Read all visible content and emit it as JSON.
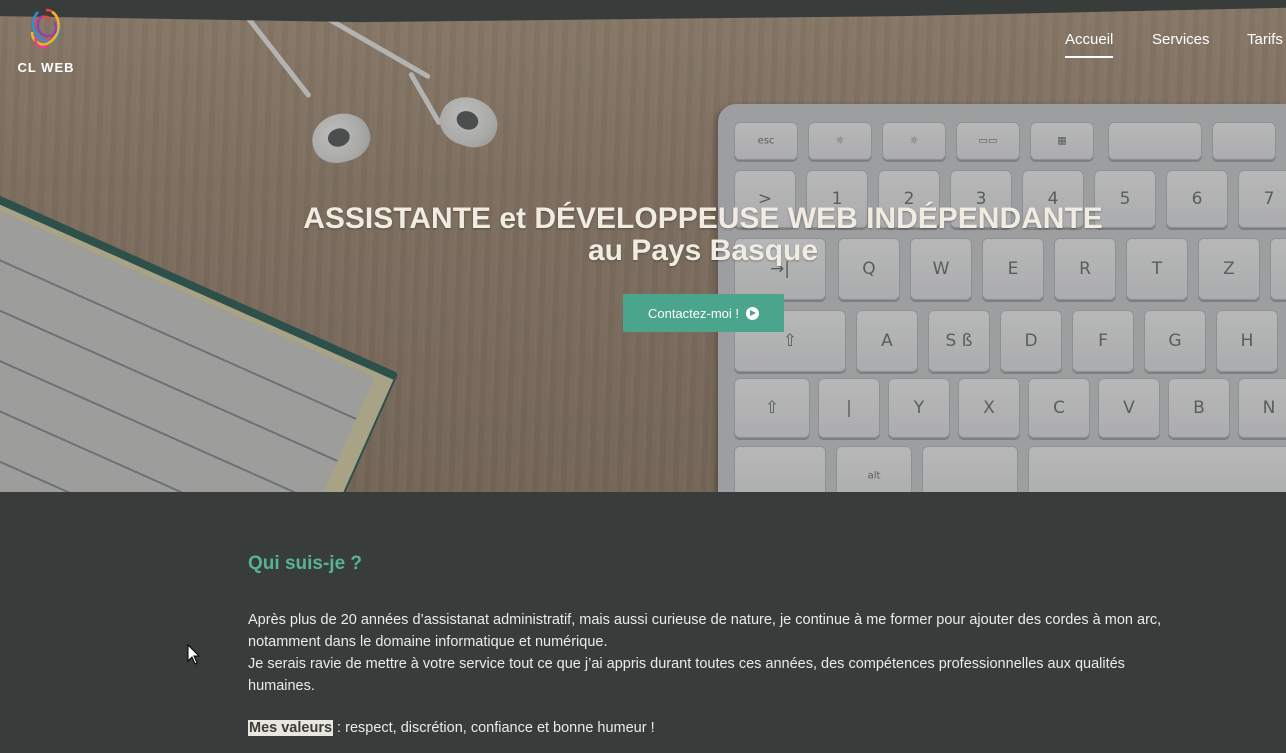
{
  "brand": {
    "logo_text": "CL WEB"
  },
  "nav": {
    "items": [
      {
        "label": "Accueil",
        "active": true
      },
      {
        "label": "Services",
        "active": false
      },
      {
        "label": "Tarifs",
        "active": false
      }
    ]
  },
  "hero": {
    "title_line1": "ASSISTANTE et DÉVELOPPEUSE WEB INDÉPENDANTE",
    "title_line2": "au Pays Basque",
    "cta_label": "Contactez-moi !"
  },
  "keyboard": {
    "row1": [
      "esc",
      "☼",
      "☼",
      "▭▭",
      "▦",
      "",
      ""
    ],
    "row2": [
      ">",
      "1",
      "2",
      "3",
      "4",
      "5",
      "6",
      "7"
    ],
    "row3": [
      "→|",
      "Q",
      "W",
      "E",
      "R",
      "T",
      "Z"
    ],
    "row4": [
      "⇧",
      "A",
      "S ß",
      "D",
      "F",
      "G",
      "H"
    ],
    "row5": [
      "⇧",
      "|",
      "Y",
      "X",
      "C",
      "V",
      "B",
      "N"
    ],
    "row6": [
      "",
      "alt",
      "",
      ""
    ]
  },
  "about": {
    "title": "Qui suis-je ?",
    "paragraph1": "Après plus de 20 années d’assistanat administratif, mais aussi curieuse de nature, je continue à me former pour ajouter des cordes à mon arc, notamment dans le domaine informatique et numérique.",
    "paragraph2": "Je serais ravie de mettre à votre service tout ce que j’ai appris durant toutes ces années, des compétences professionnelles aux qualités humaines.",
    "values_label": "Mes valeurs",
    "values_text": " : respect, discrétion, confiance et bonne humeur !"
  },
  "colors": {
    "accent": "#4aa58c",
    "heading": "#57b296",
    "background": "#383c3b"
  },
  "icons": {
    "cta": "arrow-circle-right-icon",
    "logo": "swirl-logo-icon"
  }
}
